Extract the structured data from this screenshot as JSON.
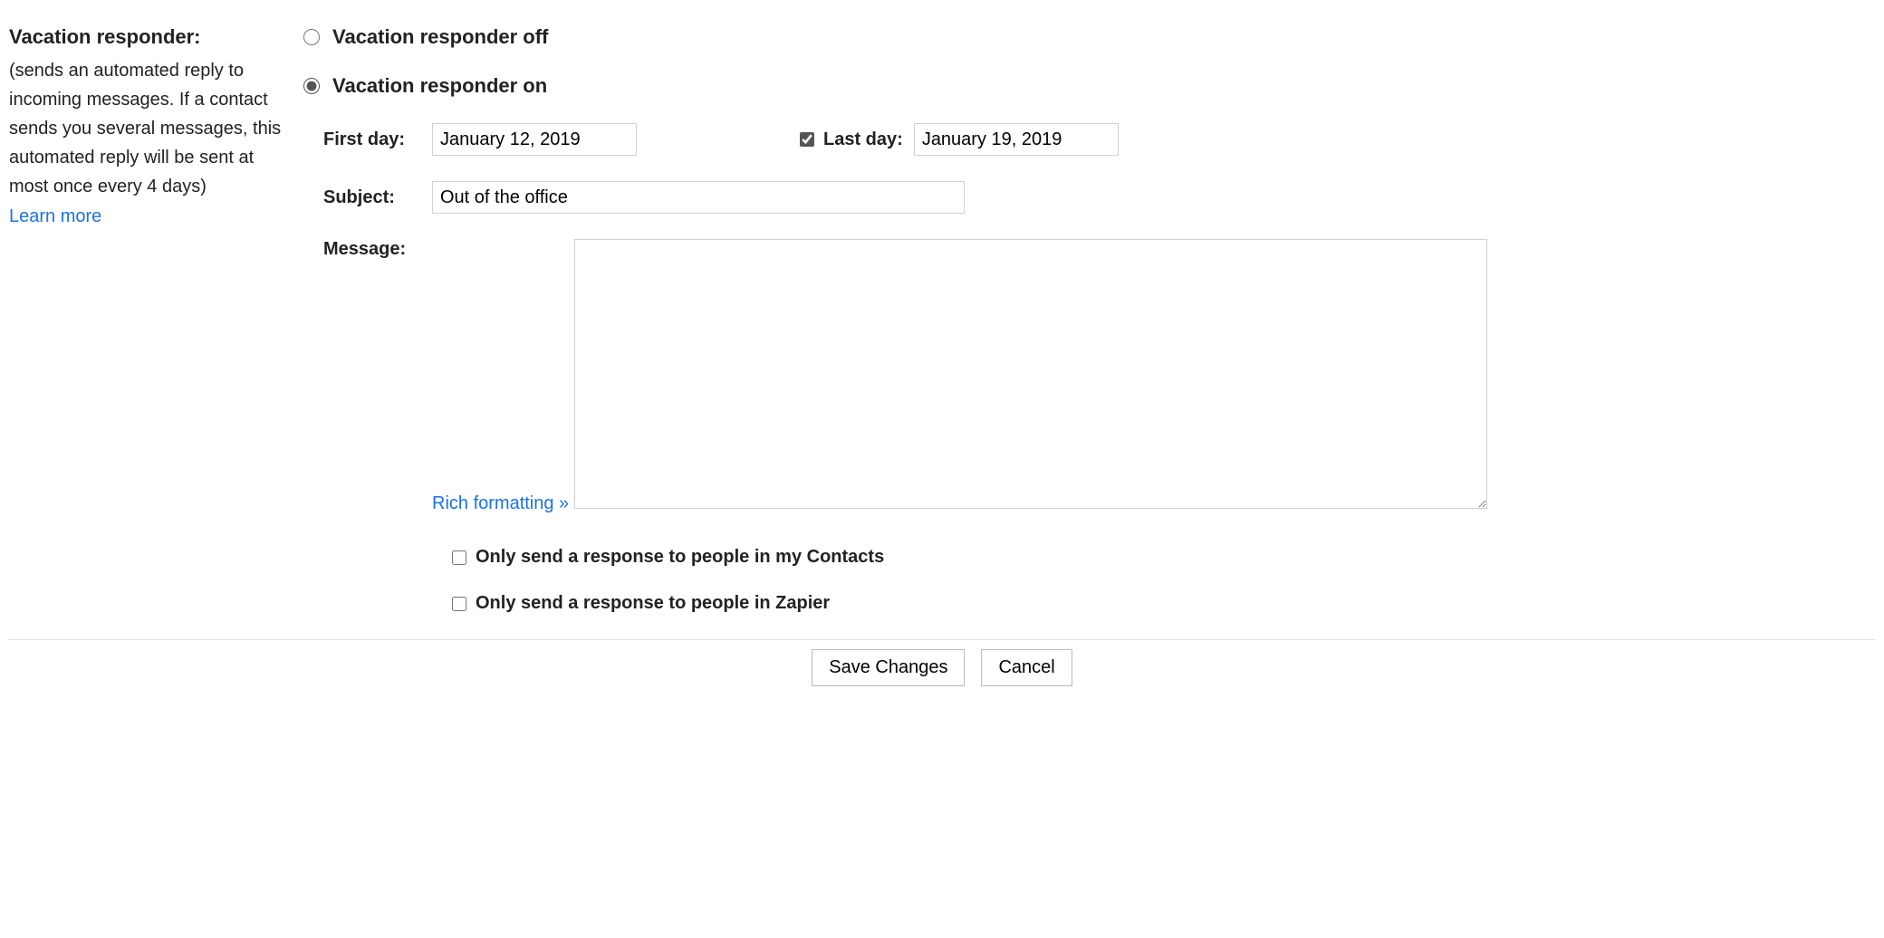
{
  "section": {
    "title": "Vacation responder:",
    "description": "(sends an automated reply to incoming messages. If a contact sends you several messages, this automated reply will be sent at most once every 4 days)",
    "learn_more": "Learn more"
  },
  "responder": {
    "off_label": "Vacation responder off",
    "on_label": "Vacation responder on",
    "selected": "on"
  },
  "fields": {
    "first_day_label": "First day:",
    "first_day_value": "January 12, 2019",
    "last_day_label": "Last day:",
    "last_day_checked": true,
    "last_day_value": "January 19, 2019",
    "subject_label": "Subject:",
    "subject_value": "Out of the office",
    "message_label": "Message:",
    "rich_formatting": "Rich formatting »",
    "message_value": ""
  },
  "options": {
    "contacts_only_label": "Only send a response to people in my Contacts",
    "contacts_only_checked": false,
    "domain_only_label": "Only send a response to people in Zapier",
    "domain_only_checked": false
  },
  "footer": {
    "save": "Save Changes",
    "cancel": "Cancel"
  }
}
